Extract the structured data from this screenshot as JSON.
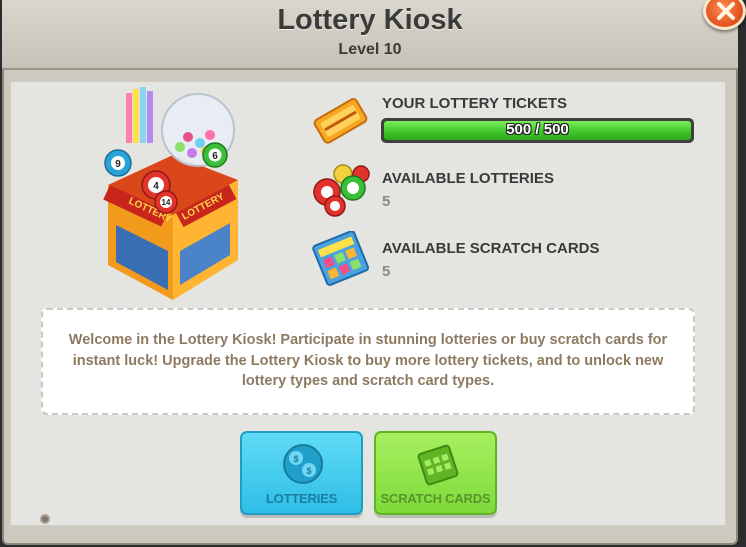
{
  "dialog": {
    "title": "Lottery Kiosk",
    "subtitle": "Level 10",
    "close_icon": "close-icon"
  },
  "stats": {
    "tickets": {
      "label": "YOUR LOTTERY TICKETS",
      "value_text": "500 / 500",
      "progress": 1.0,
      "icon": "lottery-ticket-icon"
    },
    "lotteries": {
      "label": "AVAILABLE LOTTERIES",
      "value": "5",
      "icon": "lottery-balls-icon"
    },
    "scratch_cards": {
      "label": "AVAILABLE SCRATCH CARDS",
      "value": "5",
      "icon": "scratch-card-icon"
    }
  },
  "description": "Welcome in the Lottery Kiosk! Participate in stunning lotteries or buy scratch cards for instant luck! Upgrade the Lottery Kiosk to buy more lottery tickets, and to unlock new lottery types and scratch card types.",
  "buttons": {
    "lotteries": {
      "label": "LOTTERIES",
      "icon": "lottery-ball-icon"
    },
    "scratch_cards": {
      "label": "SCRATCH CARDS",
      "icon": "scratch-card-icon"
    }
  },
  "kiosk": {
    "sign_text": "LOTTERY",
    "ball_numbers": [
      "9",
      "4",
      "6",
      "14"
    ]
  },
  "colors": {
    "accent_cyan": "#2fbde6",
    "accent_green": "#7fd93a",
    "progress_green": "#3fc72a",
    "close_orange": "#e0501e"
  }
}
